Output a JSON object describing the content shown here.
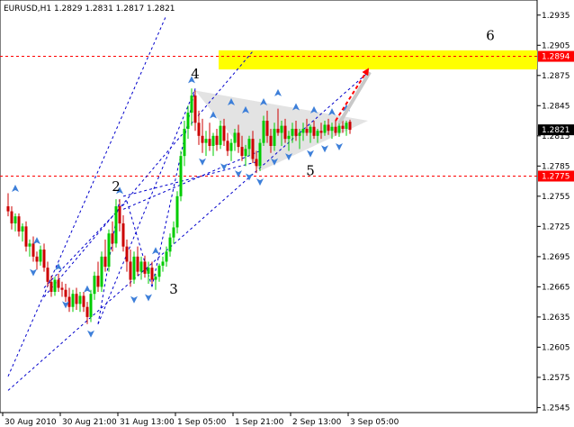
{
  "chart_data": {
    "type": "candlestick",
    "title": "EURUSD,H1  1.2829 1.2831 1.2817 1.2821",
    "symbol": "EURUSD",
    "timeframe": "H1",
    "ohlc_readout": {
      "open": 1.2829,
      "high": 1.2831,
      "low": 1.2817,
      "close": 1.2821
    },
    "ylim": [
      1.254,
      1.295
    ],
    "y_ticks": [
      "1.2935",
      "1.2905",
      "1.2875",
      "1.2845",
      "1.2815",
      "1.2785",
      "1.2755",
      "1.2725",
      "1.2695",
      "1.2665",
      "1.2635",
      "1.2605",
      "1.2575",
      "1.2545"
    ],
    "x_tick_labels": [
      "30 Aug 2010",
      "30 Aug 21:00",
      "31 Aug 13:00",
      "1 Sep 05:00",
      "1 Sep 21:00",
      "2 Sep 13:00",
      "3 Sep 05:00"
    ],
    "x_tick_index": [
      0,
      16,
      32,
      48,
      64,
      80,
      96
    ],
    "bullish_color": "#00cc00",
    "bearish_color": "#cc0000",
    "levels": [
      {
        "value": 1.2894,
        "label": "1.2894",
        "color": "#ff0000"
      },
      {
        "value": 1.2775,
        "label": "1.2775",
        "color": "#ff0000"
      },
      {
        "value": 1.2821,
        "label": "1.2821",
        "color": "#000000",
        "current": true
      }
    ],
    "target_zone": {
      "from": 1.2881,
      "to": 1.29,
      "color": "#ffff00"
    },
    "wave_labels": [
      "2",
      "3",
      "4",
      "5",
      "6"
    ],
    "candles": [
      [
        1.2745,
        1.2758,
        1.2735,
        1.274
      ],
      [
        1.274,
        1.2745,
        1.2722,
        1.2728
      ],
      [
        1.2728,
        1.2738,
        1.272,
        1.2735
      ],
      [
        1.2735,
        1.2738,
        1.2715,
        1.272
      ],
      [
        1.272,
        1.2728,
        1.271,
        1.2725
      ],
      [
        1.2725,
        1.273,
        1.27,
        1.2705
      ],
      [
        1.2705,
        1.2712,
        1.2695,
        1.2708
      ],
      [
        1.2708,
        1.2715,
        1.269,
        1.2695
      ],
      [
        1.2695,
        1.27,
        1.2682,
        1.269
      ],
      [
        1.269,
        1.2706,
        1.2686,
        1.2702
      ],
      [
        1.2702,
        1.2708,
        1.268,
        1.2684
      ],
      [
        1.2684,
        1.269,
        1.2665,
        1.267
      ],
      [
        1.267,
        1.2676,
        1.2655,
        1.266
      ],
      [
        1.266,
        1.2675,
        1.2656,
        1.2672
      ],
      [
        1.2672,
        1.2678,
        1.266,
        1.2664
      ],
      [
        1.2664,
        1.267,
        1.2655,
        1.2662
      ],
      [
        1.2662,
        1.2668,
        1.265,
        1.2655
      ],
      [
        1.2655,
        1.2664,
        1.264,
        1.2645
      ],
      [
        1.2645,
        1.2662,
        1.264,
        1.2658
      ],
      [
        1.2658,
        1.2664,
        1.2642,
        1.2648
      ],
      [
        1.2648,
        1.266,
        1.264,
        1.2656
      ],
      [
        1.2656,
        1.266,
        1.264,
        1.2645
      ],
      [
        1.2645,
        1.265,
        1.2628,
        1.2635
      ],
      [
        1.2635,
        1.2662,
        1.263,
        1.2658
      ],
      [
        1.2658,
        1.268,
        1.2652,
        1.2676
      ],
      [
        1.2676,
        1.269,
        1.266,
        1.2665
      ],
      [
        1.2665,
        1.27,
        1.266,
        1.2695
      ],
      [
        1.2695,
        1.2712,
        1.268,
        1.2685
      ],
      [
        1.2685,
        1.2722,
        1.268,
        1.2718
      ],
      [
        1.2718,
        1.273,
        1.27,
        1.2708
      ],
      [
        1.2708,
        1.2752,
        1.2704,
        1.2745
      ],
      [
        1.2745,
        1.2752,
        1.272,
        1.2728
      ],
      [
        1.2728,
        1.2736,
        1.27,
        1.2705
      ],
      [
        1.2705,
        1.2712,
        1.268,
        1.269
      ],
      [
        1.269,
        1.2702,
        1.2665,
        1.2672
      ],
      [
        1.2672,
        1.27,
        1.2668,
        1.2695
      ],
      [
        1.2695,
        1.2705,
        1.2676,
        1.268
      ],
      [
        1.268,
        1.2695,
        1.2672,
        1.269
      ],
      [
        1.269,
        1.2696,
        1.2674,
        1.2678
      ],
      [
        1.2678,
        1.269,
        1.2668,
        1.2684
      ],
      [
        1.2684,
        1.269,
        1.2668,
        1.2672
      ],
      [
        1.2672,
        1.2678,
        1.2662,
        1.2675
      ],
      [
        1.2675,
        1.2688,
        1.267,
        1.2686
      ],
      [
        1.2686,
        1.2695,
        1.268,
        1.269
      ],
      [
        1.269,
        1.2705,
        1.2685,
        1.27
      ],
      [
        1.27,
        1.2718,
        1.2695,
        1.2714
      ],
      [
        1.2714,
        1.273,
        1.2708,
        1.2724
      ],
      [
        1.2724,
        1.276,
        1.2718,
        1.2755
      ],
      [
        1.2755,
        1.28,
        1.275,
        1.2795
      ],
      [
        1.2795,
        1.283,
        1.2785,
        1.2822
      ],
      [
        1.2822,
        1.2845,
        1.2812,
        1.2838
      ],
      [
        1.2838,
        1.2862,
        1.2825,
        1.2855
      ],
      [
        1.2855,
        1.286,
        1.282,
        1.2828
      ],
      [
        1.2828,
        1.284,
        1.2806,
        1.2815
      ],
      [
        1.2815,
        1.2832,
        1.2798,
        1.2808
      ],
      [
        1.2808,
        1.282,
        1.2795,
        1.2812
      ],
      [
        1.2812,
        1.2828,
        1.28,
        1.2805
      ],
      [
        1.2805,
        1.2818,
        1.2795,
        1.2815
      ],
      [
        1.2815,
        1.2822,
        1.28,
        1.2806
      ],
      [
        1.2806,
        1.283,
        1.2802,
        1.2825
      ],
      [
        1.2825,
        1.2832,
        1.2805,
        1.281
      ],
      [
        1.281,
        1.2818,
        1.2795,
        1.28
      ],
      [
        1.28,
        1.2812,
        1.279,
        1.2808
      ],
      [
        1.2808,
        1.2822,
        1.28,
        1.2818
      ],
      [
        1.2818,
        1.2826,
        1.2798,
        1.2804
      ],
      [
        1.2804,
        1.2815,
        1.279,
        1.2795
      ],
      [
        1.2795,
        1.2806,
        1.2785,
        1.2802
      ],
      [
        1.2802,
        1.2815,
        1.2795,
        1.2812
      ],
      [
        1.2812,
        1.282,
        1.2788,
        1.2792
      ],
      [
        1.2792,
        1.28,
        1.2778,
        1.2785
      ],
      [
        1.2785,
        1.2812,
        1.278,
        1.2808
      ],
      [
        1.2808,
        1.2835,
        1.2805,
        1.283
      ],
      [
        1.283,
        1.284,
        1.2808,
        1.2815
      ],
      [
        1.2815,
        1.2822,
        1.2798,
        1.2805
      ],
      [
        1.2805,
        1.2828,
        1.28,
        1.2822
      ],
      [
        1.2822,
        1.2842,
        1.2815,
        1.2818
      ],
      [
        1.2818,
        1.283,
        1.2805,
        1.2825
      ],
      [
        1.2825,
        1.2832,
        1.2808,
        1.2812
      ],
      [
        1.2812,
        1.282,
        1.28,
        1.2815
      ],
      [
        1.2815,
        1.2828,
        1.2808,
        1.2822
      ],
      [
        1.2822,
        1.283,
        1.281,
        1.2815
      ],
      [
        1.2815,
        1.2822,
        1.2802,
        1.2818
      ],
      [
        1.2818,
        1.2828,
        1.281,
        1.2822
      ],
      [
        1.2822,
        1.2832,
        1.2815,
        1.2818
      ],
      [
        1.2818,
        1.2826,
        1.2808,
        1.2824
      ],
      [
        1.2824,
        1.283,
        1.2812,
        1.2815
      ],
      [
        1.2815,
        1.2822,
        1.2808,
        1.282
      ],
      [
        1.282,
        1.2828,
        1.2812,
        1.2818
      ],
      [
        1.2818,
        1.283,
        1.2815,
        1.2826
      ],
      [
        1.2826,
        1.2832,
        1.2816,
        1.282
      ],
      [
        1.282,
        1.2828,
        1.2812,
        1.2824
      ],
      [
        1.2824,
        1.283,
        1.2815,
        1.2818
      ],
      [
        1.2818,
        1.2828,
        1.2814,
        1.2825
      ],
      [
        1.2825,
        1.2832,
        1.2818,
        1.2822
      ],
      [
        1.2822,
        1.283,
        1.2815,
        1.2828
      ],
      [
        1.2829,
        1.2831,
        1.2817,
        1.2821
      ]
    ],
    "trendlines": [
      {
        "from": [
          0,
          1.2562
        ],
        "to": [
          100,
          1.2878
        ]
      },
      {
        "from": [
          0,
          1.2576
        ],
        "to": [
          44,
          1.2935
        ]
      },
      {
        "from": [
          10,
          1.2655
        ],
        "to": [
          68,
          1.2899
        ]
      },
      {
        "from": [
          25,
          1.2628
        ],
        "to": [
          31,
          1.2752
        ]
      },
      {
        "from": [
          25,
          1.2628
        ],
        "to": [
          52,
          1.2862
        ]
      },
      {
        "from": [
          10,
          1.2664
        ],
        "to": [
          33,
          1.275
        ]
      },
      {
        "from": [
          33,
          1.275
        ],
        "to": [
          40,
          1.2665
        ]
      },
      {
        "from": [
          40,
          1.2665
        ],
        "to": [
          52,
          1.2862
        ]
      },
      {
        "from": [
          32,
          1.2742
        ],
        "to": [
          70,
          1.28
        ]
      },
      {
        "from": [
          32,
          1.2755
        ],
        "to": [
          70,
          1.279
        ]
      }
    ],
    "triangle": [
      [
        52,
        1.286
      ],
      [
        70,
        1.278
      ],
      [
        100,
        1.283
      ]
    ],
    "forecast_arrow": {
      "from": [
        91,
        1.283
      ],
      "to": [
        100,
        1.2881
      ]
    },
    "fractals_up": [
      [
        2,
        1.2762
      ],
      [
        8,
        1.271
      ],
      [
        14,
        1.2684
      ],
      [
        22,
        1.2662
      ],
      [
        31,
        1.276
      ],
      [
        41,
        1.27
      ],
      [
        51,
        1.287
      ],
      [
        57,
        1.2835
      ],
      [
        62,
        1.2848
      ],
      [
        66,
        1.284
      ],
      [
        71,
        1.2848
      ],
      [
        75,
        1.2857
      ],
      [
        80,
        1.2843
      ],
      [
        85,
        1.284
      ],
      [
        90,
        1.2838
      ],
      [
        94,
        1.2842
      ]
    ],
    "fractals_down": [
      [
        7,
        1.268
      ],
      [
        16,
        1.2648
      ],
      [
        23,
        1.2619
      ],
      [
        35,
        1.2653
      ],
      [
        39,
        1.2655
      ],
      [
        54,
        1.279
      ],
      [
        60,
        1.2785
      ],
      [
        64,
        1.2778
      ],
      [
        67,
        1.2775
      ],
      [
        70,
        1.277
      ],
      [
        74,
        1.279
      ],
      [
        78,
        1.2795
      ],
      [
        84,
        1.2798
      ],
      [
        88,
        1.2803
      ],
      [
        92,
        1.2805
      ]
    ]
  }
}
